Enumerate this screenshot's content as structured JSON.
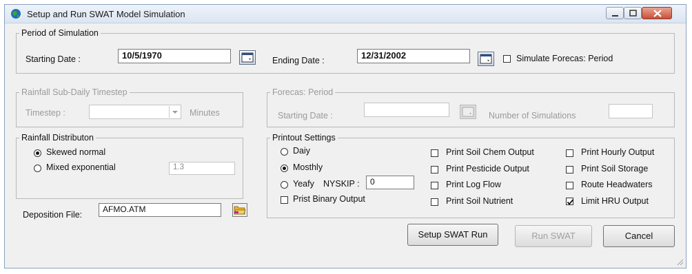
{
  "window": {
    "title": "Setup and Run SWAT Model Simulation",
    "icon": "swat-globe-icon",
    "controls": [
      "minimize-icon",
      "maximize-icon",
      "close-icon"
    ]
  },
  "period": {
    "legend": "Period of Simulation",
    "start_label": "Starting Date :",
    "start_value": "10/5/1970",
    "end_label": "Ending Date :",
    "end_value": "12/31/2002",
    "forecast_checkbox_label": "Simulate Forecas: Period",
    "forecast_checked": false
  },
  "rainfall_timestep": {
    "legend": "Rainfall Sub-Daily Timestep",
    "timestep_label": "Timestep :",
    "timestep_value": "",
    "unit_label": "Minutes",
    "enabled": false
  },
  "forecast_period": {
    "legend": "Forecas: Period",
    "start_label": "Starting Date :",
    "start_value": "",
    "num_sims_label": "Number of Simulations",
    "num_sims_value": "",
    "enabled": false
  },
  "rainfall_distribution": {
    "legend": "Rainfall Distributon",
    "options": [
      {
        "label": "Skewed normal",
        "selected": true
      },
      {
        "label": "Mixed exponential",
        "selected": false
      }
    ],
    "exponent_value": "1.3"
  },
  "deposition": {
    "label": "Deposition File:",
    "value": "AFMO.ATM",
    "browse_icon": "folder-open-icon"
  },
  "printout": {
    "legend": "Printout Settings",
    "frequency": [
      {
        "label": "Daiy",
        "selected": false
      },
      {
        "label": "Mosthly",
        "selected": true
      },
      {
        "label": "Yeafy",
        "selected": false
      }
    ],
    "nyskip_label": "NYSKIP :",
    "nyskip_value": "0",
    "binary_label": "Prist Binary Output",
    "binary_checked": false,
    "col2": [
      {
        "label": "Print Soil Chem Output",
        "checked": false
      },
      {
        "label": "Print Pesticide Output",
        "checked": false
      },
      {
        "label": "Print Log Flow",
        "checked": false
      },
      {
        "label": "Print Soil Nutrient",
        "checked": false
      }
    ],
    "col3": [
      {
        "label": "Print Hourly Output",
        "checked": false
      },
      {
        "label": "Print Soil Storage",
        "checked": false
      },
      {
        "label": "Route Headwaters",
        "checked": false
      },
      {
        "label": "Limit HRU Output",
        "checked": true
      }
    ]
  },
  "buttons": {
    "setup": "Setup SWAT Run",
    "run": "Run SWAT",
    "cancel": "Cancel"
  }
}
